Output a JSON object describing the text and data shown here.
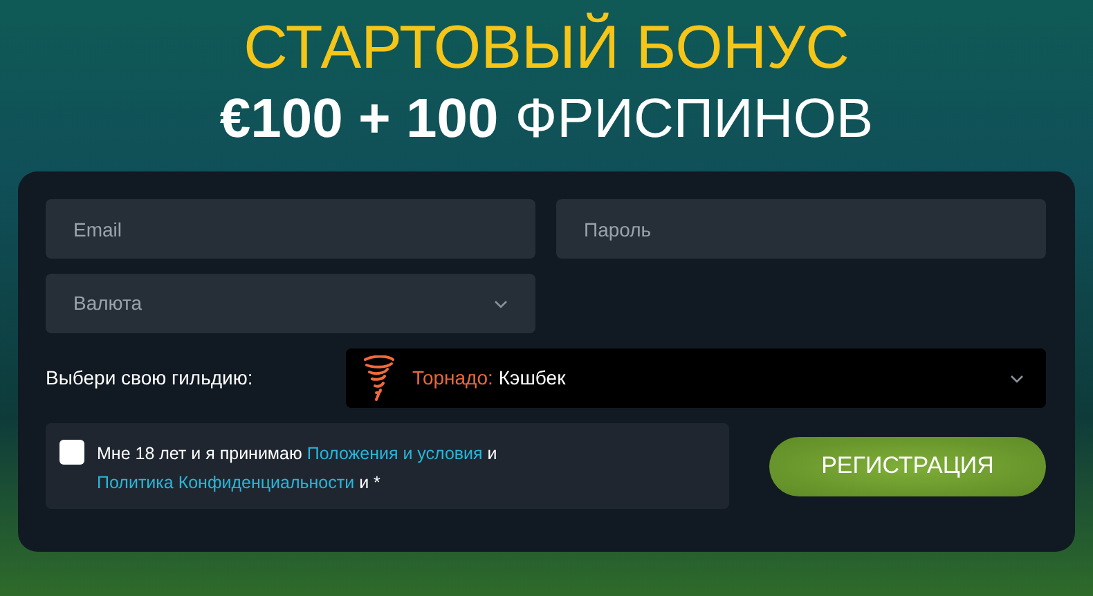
{
  "header": {
    "title": "СТАРТОВЫЙ БОНУС",
    "amount": "€100 + 100",
    "amount_suffix": "ФРИСПИНОВ"
  },
  "form": {
    "email": {
      "placeholder": "Email"
    },
    "password": {
      "placeholder": "Пароль"
    },
    "currency": {
      "placeholder": "Валюта"
    },
    "guild": {
      "label": "Выбери свою гильдию:",
      "name": "Торнадо:",
      "perk": "Кэшбек"
    },
    "consent": {
      "checked": false,
      "parts": [
        {
          "kind": "text",
          "text": "Мне 18 лет и я принимаю"
        },
        {
          "kind": "link",
          "text": "Положения и условия"
        },
        {
          "kind": "text",
          "text": "и"
        },
        {
          "kind": "link",
          "text": "Политика Конфиденциальности"
        },
        {
          "kind": "text",
          "text": "и *"
        }
      ]
    },
    "submit": "РЕГИСТРАЦИЯ"
  }
}
